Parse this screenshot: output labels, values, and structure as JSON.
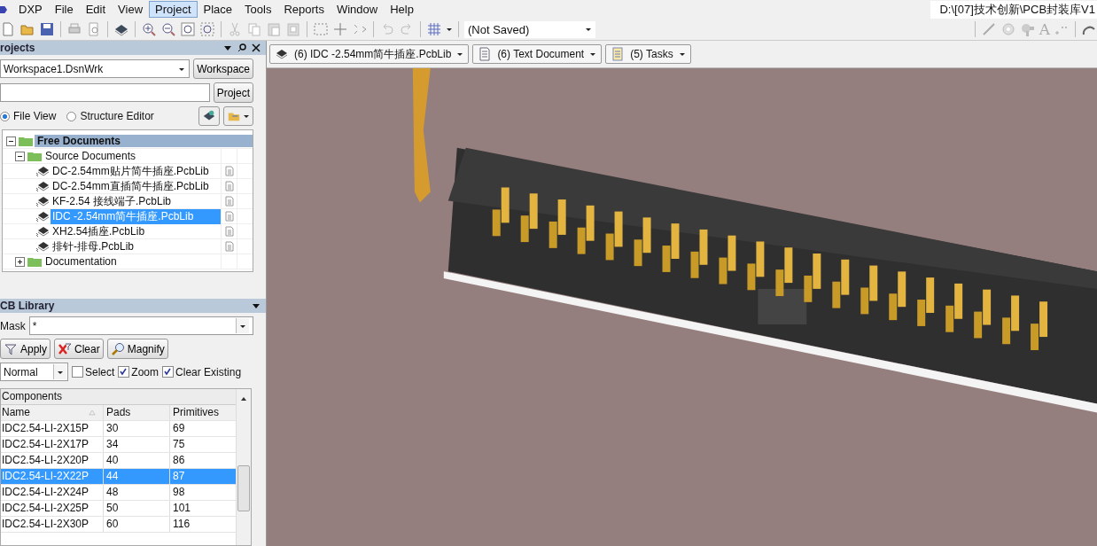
{
  "menu": [
    {
      "label": "DXP",
      "selected": false
    },
    {
      "label": "File",
      "selected": false
    },
    {
      "label": "Edit",
      "selected": false
    },
    {
      "label": "View",
      "selected": false
    },
    {
      "label": "Project",
      "selected": true
    },
    {
      "label": "Place",
      "selected": false
    },
    {
      "label": "Tools",
      "selected": false
    },
    {
      "label": "Reports",
      "selected": false
    },
    {
      "label": "Window",
      "selected": false
    },
    {
      "label": "Help",
      "selected": false
    }
  ],
  "title_path": "D:\\[07]技术创新\\PCB封装库V1",
  "toolbar": {
    "view_combo": "(Not Saved)",
    "text_tool": "A"
  },
  "doc_tabs": [
    {
      "label": "(6) IDC -2.54mm简牛插座.PcbLib",
      "kind": "pcblib"
    },
    {
      "label": "(6) Text Document",
      "kind": "text"
    },
    {
      "label": "(5) Tasks",
      "kind": "tasks"
    }
  ],
  "projects": {
    "title": "rojects",
    "workspace": "Workspace1.DsnWrk",
    "workspace_button": "Workspace",
    "project_button": "Project",
    "views": [
      {
        "label": "File View",
        "selected": true
      },
      {
        "label": "Structure Editor",
        "selected": false
      }
    ],
    "tree": [
      {
        "label": "Free Documents",
        "expanded": true,
        "children": [
          {
            "label": "Source Documents",
            "expanded": true,
            "children": [
              {
                "label": "DC-2.54mm贴片简牛插座.PcbLib",
                "selected": false
              },
              {
                "label": "DC-2.54mm直插简牛插座.PcbLib",
                "selected": false
              },
              {
                "label": "KF-2.54 接线端子.PcbLib",
                "selected": false
              },
              {
                "label": "IDC -2.54mm简牛插座.PcbLib",
                "selected": true
              },
              {
                "label": "XH2.54插座.PcbLib",
                "selected": false
              },
              {
                "label": "排针-排母.PcbLib",
                "selected": false
              }
            ]
          },
          {
            "label": "Documentation",
            "expanded": false
          }
        ]
      }
    ]
  },
  "pcb_library": {
    "title": "CB Library",
    "mask_label": "Mask",
    "mask": "*",
    "buttons": [
      {
        "label": "Apply",
        "kind": "filter"
      },
      {
        "label": "Clear",
        "kind": "clear"
      },
      {
        "label": "Magnify",
        "kind": "magnify"
      }
    ],
    "mode": "Normal",
    "options": [
      {
        "label": "Select",
        "checked": false
      },
      {
        "label": "Zoom",
        "checked": true
      },
      {
        "label": "Clear Existing",
        "checked": true
      }
    ],
    "table": {
      "caption": "Components",
      "columns": [
        "Name",
        "Pads",
        "Primitives"
      ],
      "rows": [
        {
          "cells": [
            "IDC2.54-LI-2X15P",
            "30",
            "69"
          ],
          "selected": false
        },
        {
          "cells": [
            "IDC2.54-LI-2X17P",
            "34",
            "75"
          ],
          "selected": false
        },
        {
          "cells": [
            "IDC2.54-LI-2X20P",
            "40",
            "86"
          ],
          "selected": false
        },
        {
          "cells": [
            "IDC2.54-LI-2X22P",
            "44",
            "87"
          ],
          "selected": true
        },
        {
          "cells": [
            "IDC2.54-LI-2X24P",
            "48",
            "98"
          ],
          "selected": false
        },
        {
          "cells": [
            "IDC2.54-LI-2X25P",
            "50",
            "101"
          ],
          "selected": false
        },
        {
          "cells": [
            "IDC2.54-LI-2X30P",
            "60",
            "116"
          ],
          "selected": false
        }
      ]
    }
  }
}
